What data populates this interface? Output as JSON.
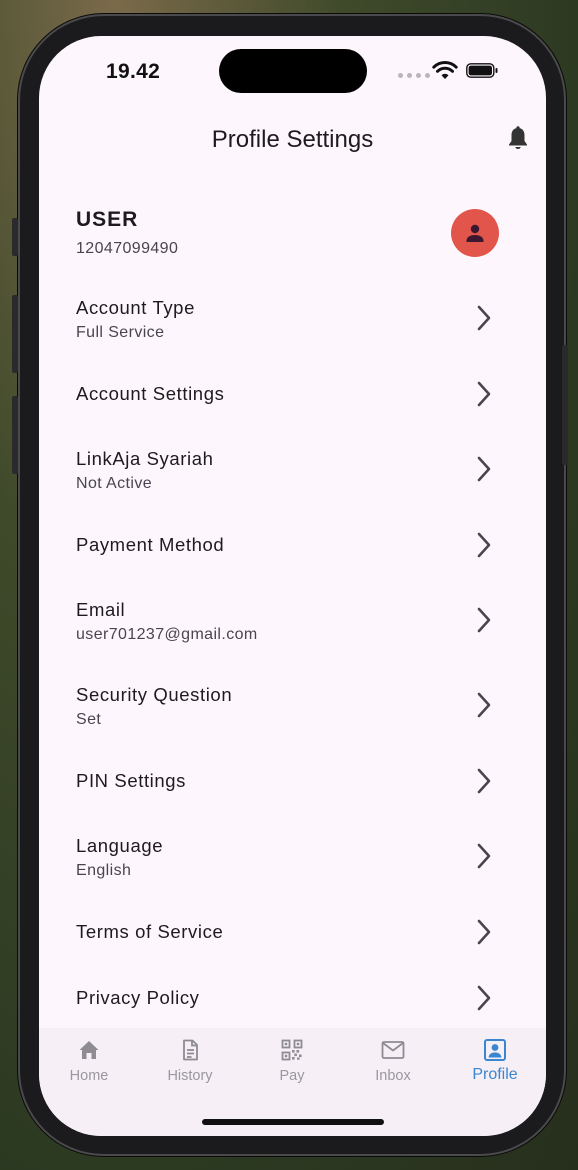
{
  "status": {
    "time": "19.42"
  },
  "header": {
    "title": "Profile Settings"
  },
  "user": {
    "name": "USER",
    "phone": "12047099490"
  },
  "menu": [
    {
      "label": "Account Type",
      "sub": "Full Service"
    },
    {
      "label": "Account Settings"
    },
    {
      "label": "LinkAja Syariah",
      "sub": "Not Active"
    },
    {
      "label": "Payment Method"
    },
    {
      "label": "Email",
      "sub": "user701237@gmail.com"
    },
    {
      "label": "Security Question",
      "sub": "Set"
    },
    {
      "label": "PIN Settings"
    },
    {
      "label": "Language",
      "sub": "English"
    },
    {
      "label": "Terms of Service"
    },
    {
      "label": "Privacy Policy"
    }
  ],
  "nav": [
    {
      "label": "Home",
      "icon": "home-icon"
    },
    {
      "label": "History",
      "icon": "history-icon"
    },
    {
      "label": "Pay",
      "icon": "qr-code-icon"
    },
    {
      "label": "Inbox",
      "icon": "mail-icon"
    },
    {
      "label": "Profile",
      "icon": "profile-icon",
      "active": true
    }
  ],
  "colors": {
    "background": "#fdf7fd",
    "avatar": "#e2554a",
    "active_nav": "#3a86d0",
    "inactive_nav": "#9a97a0"
  }
}
